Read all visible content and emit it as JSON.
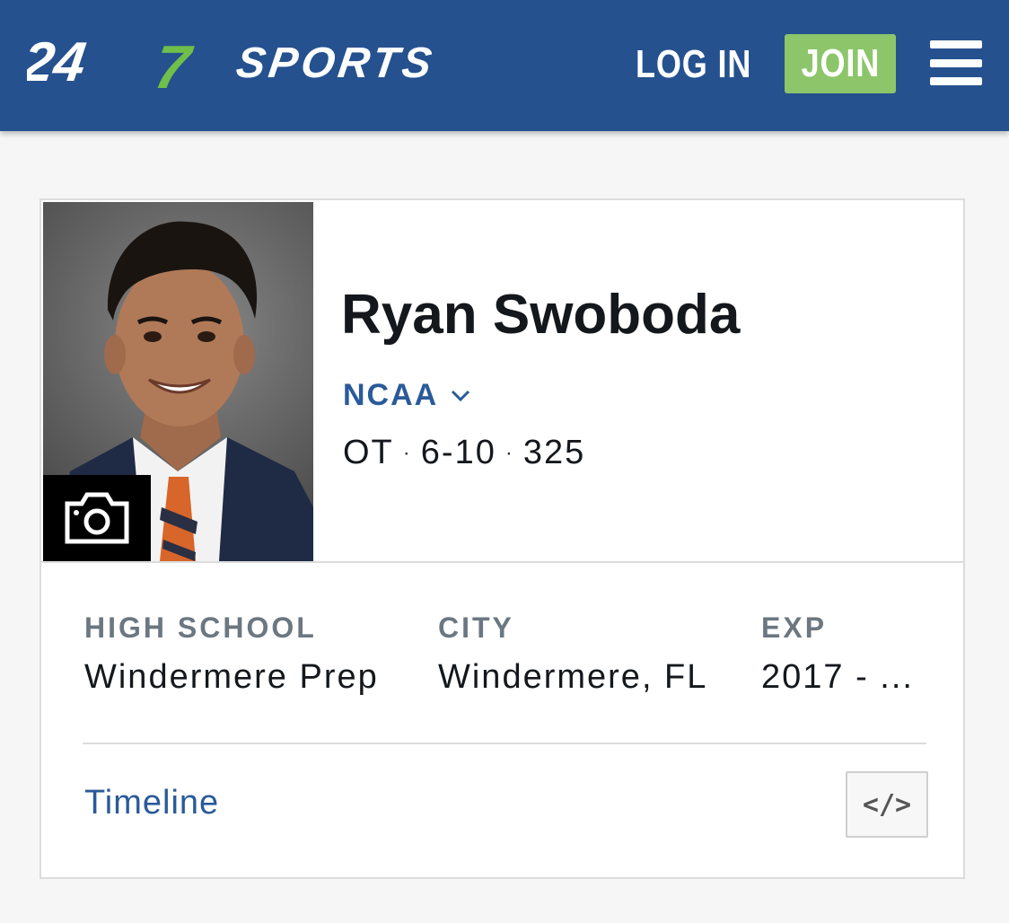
{
  "header": {
    "logo_text": "247SPORTS",
    "login_label": "LOG IN",
    "join_label": "JOIN",
    "menu_icon": "hamburger-menu-icon",
    "colors": {
      "bar": "#25518f",
      "join": "#8cc56a",
      "logo_accent": "#6fbf4a"
    }
  },
  "player": {
    "name": "Ryan Swoboda",
    "league": "NCAA",
    "position": "OT",
    "height": "6-10",
    "weight": "325",
    "photo_overlay_icon": "camera-icon"
  },
  "meta": {
    "high_school_label": "HIGH SCHOOL",
    "high_school": "Windermere Prep",
    "city_label": "CITY",
    "city": "Windermere, FL",
    "exp_label": "EXP",
    "exp": "2017 - ..."
  },
  "footer": {
    "timeline_label": "Timeline",
    "embed_label": "</>"
  }
}
